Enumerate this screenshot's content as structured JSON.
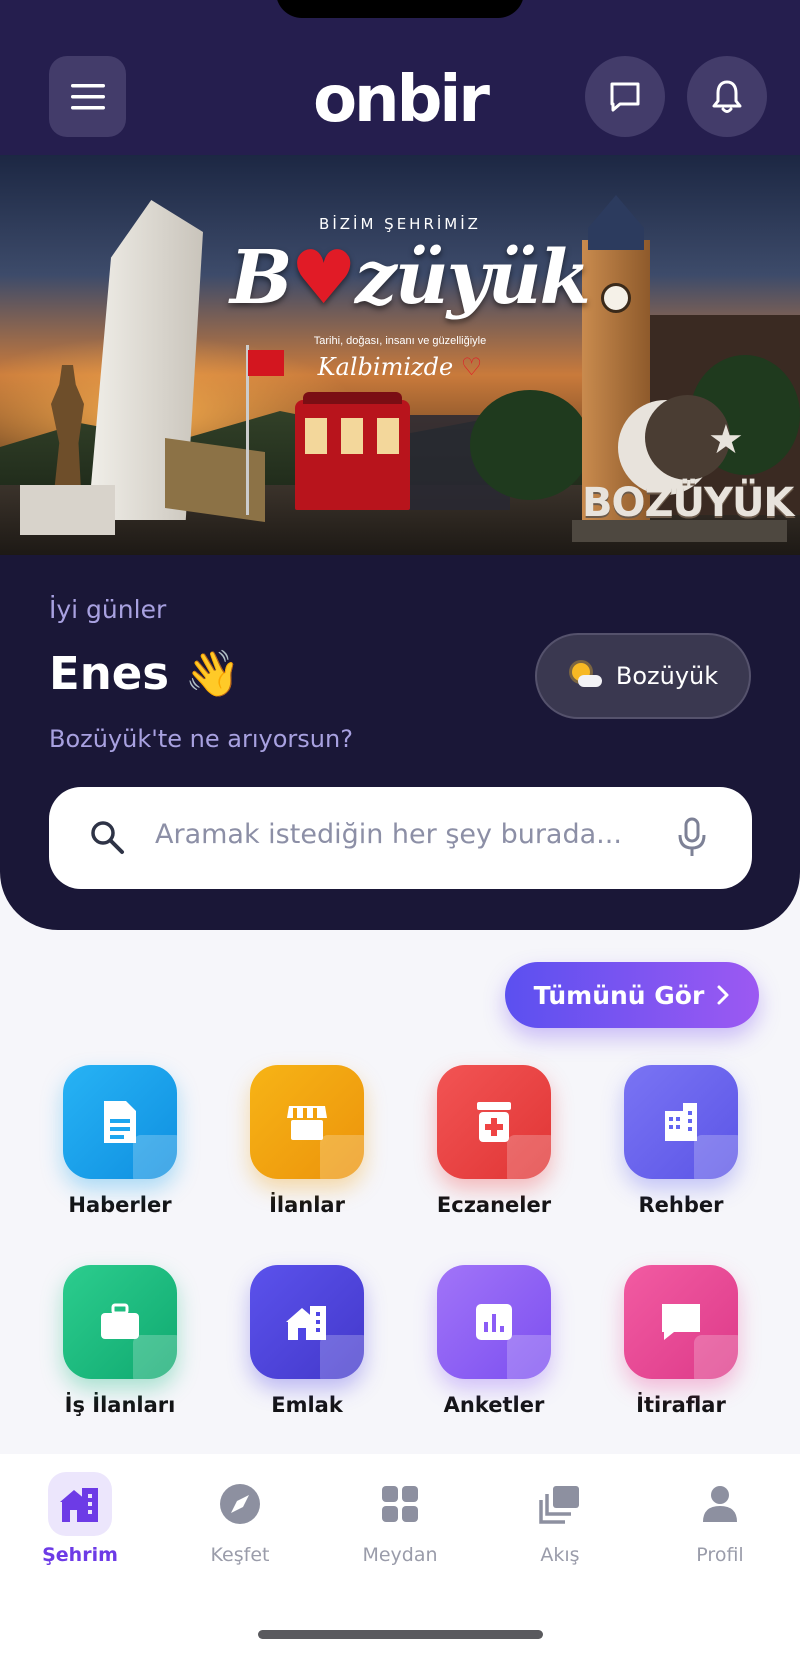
{
  "header": {
    "logo": "onbir"
  },
  "banner": {
    "kicker": "BİZİM ŞEHRİMİZ",
    "title_pre": "B",
    "title_post": "züyük",
    "subtitle": "Tarihi, doğası, insanı ve güzelliğiyle",
    "script": "Kalbimizde",
    "city_sign": "BOZÜYÜK"
  },
  "greeting": {
    "hello": "İyi günler",
    "name": "Enes 👋",
    "question": "Bozüyük'te ne arıyorsun?",
    "location": "Bozüyük"
  },
  "search": {
    "placeholder": "Aramak istediğin her şey burada..."
  },
  "see_all": "Tümünü Gör",
  "categories": [
    {
      "label": "Haberler",
      "icon": "document-icon",
      "color": "#1ea6ef"
    },
    {
      "label": "İlanlar",
      "icon": "storefront-icon",
      "color": "#f2a10d"
    },
    {
      "label": "Eczaneler",
      "icon": "pharmacy-icon",
      "color": "#ef4444"
    },
    {
      "label": "Rehber",
      "icon": "building-icon",
      "color": "#6366f1"
    },
    {
      "label": "İş İlanları",
      "icon": "briefcase-icon",
      "color": "#16b981"
    },
    {
      "label": "Emlak",
      "icon": "house-icon",
      "color": "#4f46e5"
    },
    {
      "label": "Anketler",
      "icon": "poll-icon",
      "color": "#8b5cf6"
    },
    {
      "label": "İtiraflar",
      "icon": "speech-bubble-icon",
      "color": "#ec4899"
    }
  ],
  "tabs": [
    {
      "label": "Şehrim",
      "icon": "city-icon",
      "active": true
    },
    {
      "label": "Keşfet",
      "icon": "compass-icon",
      "active": false
    },
    {
      "label": "Meydan",
      "icon": "grid-icon",
      "active": false
    },
    {
      "label": "Akış",
      "icon": "feed-icon",
      "active": false
    },
    {
      "label": "Profil",
      "icon": "person-icon",
      "active": false
    }
  ],
  "colors": {
    "header_bg": "#251e4e",
    "panel_bg": "#1a1737",
    "accent": "#6d3be6"
  }
}
